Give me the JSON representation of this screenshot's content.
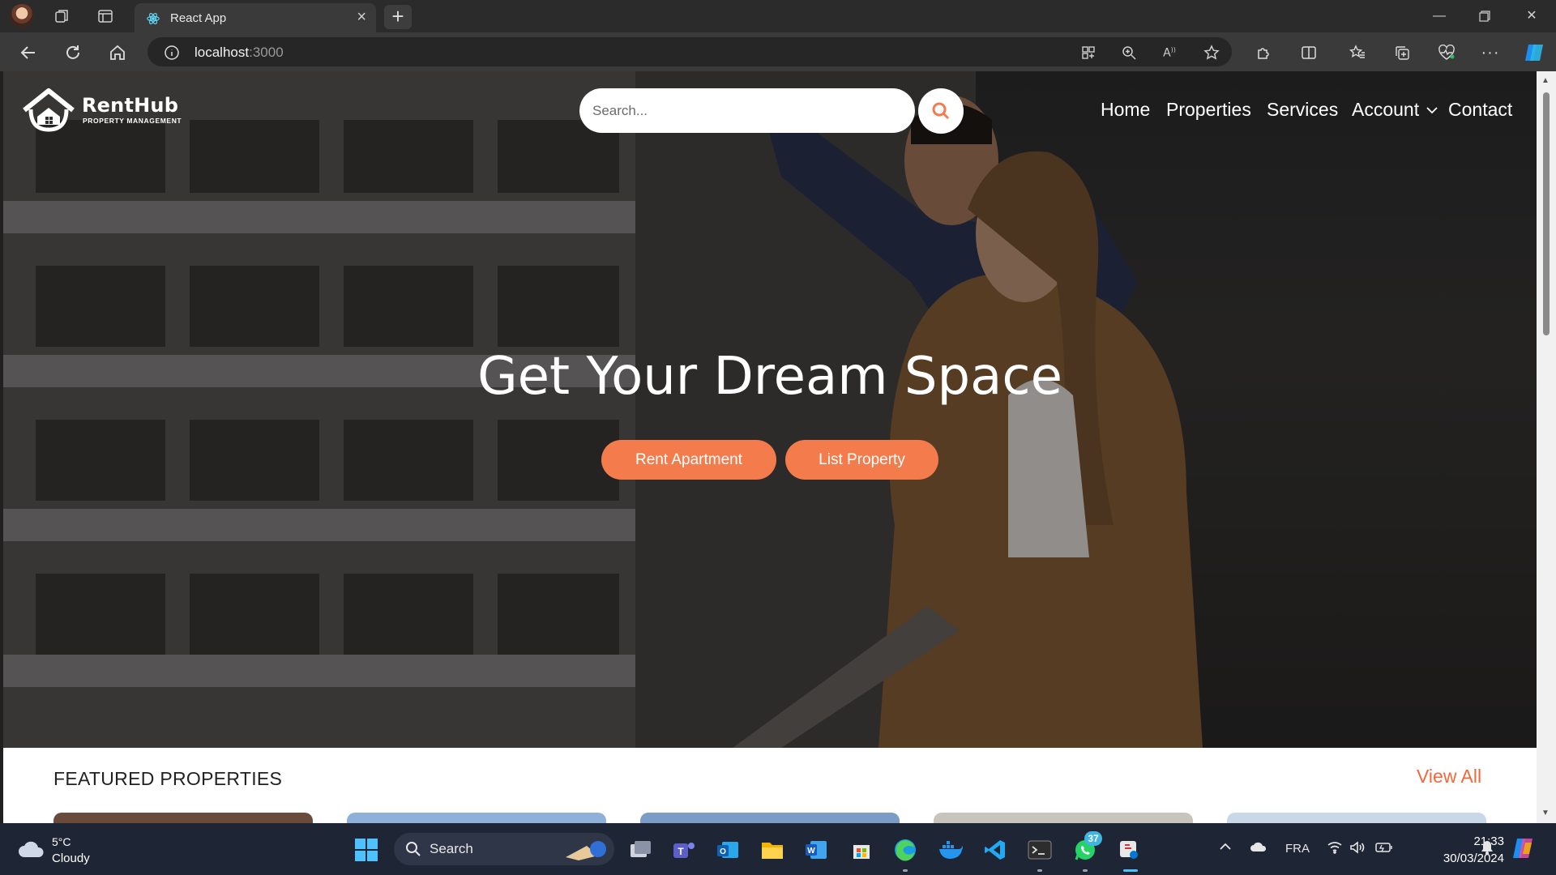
{
  "browser": {
    "tab_title": "React App",
    "url_host": "localhost",
    "url_port": ":3000"
  },
  "site": {
    "logo_name": "RentHub",
    "logo_tagline": "PROPERTY MANAGEMENT",
    "search_placeholder": "Search...",
    "nav": {
      "home": "Home",
      "properties": "Properties",
      "services": "Services",
      "account": "Account",
      "contact": "Contact"
    },
    "hero_title": "Get Your Dream Space",
    "rent_button": "Rent Apartment",
    "list_button": "List Property",
    "featured_heading": "FEATURED PROPERTIES",
    "view_all": "View All"
  },
  "taskbar": {
    "temperature": "5°C",
    "weather": "Cloudy",
    "search_label": "Search",
    "whatsapp_badge": "37",
    "language": "FRA",
    "time": "21:33",
    "date": "30/03/2024"
  },
  "colors": {
    "accent": "#f47c4c",
    "view_all": "#f2683a",
    "taskbar": "#1e2535"
  }
}
